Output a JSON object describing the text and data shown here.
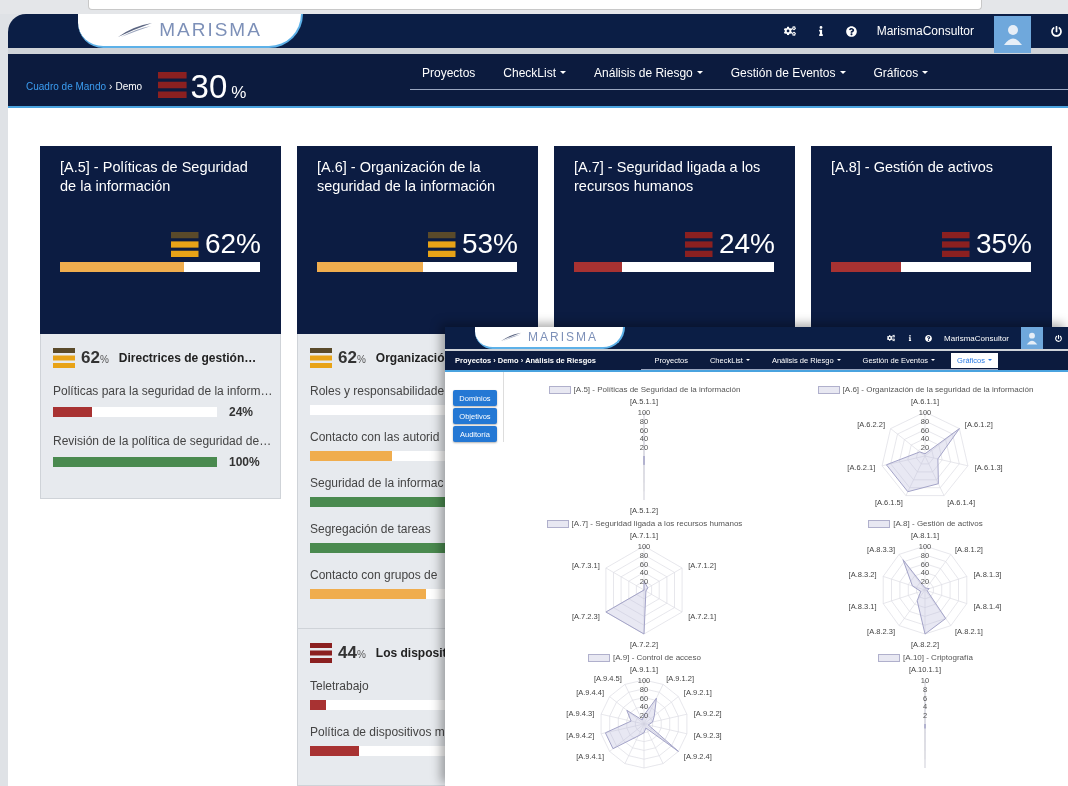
{
  "header": {
    "logo": "MARISMA",
    "user": "MarismaConsultor"
  },
  "subheader": {
    "breadcrumb": [
      {
        "label": "Cuadro de Mando",
        "link": true
      },
      {
        "label": "Demo",
        "link": false
      }
    ],
    "separator": "›",
    "total": {
      "value": "30",
      "unit": "%"
    },
    "nav": [
      {
        "label": "Proyectos",
        "dropdown": false
      },
      {
        "label": "CheckList",
        "dropdown": true
      },
      {
        "label": "Análisis de Riesgo",
        "dropdown": true
      },
      {
        "label": "Gestión de Eventos",
        "dropdown": true
      },
      {
        "label": "Gráficos",
        "dropdown": true
      }
    ]
  },
  "cards": [
    {
      "title": "[A.5] - Políticas de Seguridad de la información",
      "value": "62%",
      "level": 0.62
    },
    {
      "title": "[A.6] - Organización de la seguridad de la información",
      "value": "53%",
      "level": 0.53
    },
    {
      "title": "[A.7] - Seguridad ligada a los recursos humanos",
      "value": "24%",
      "level": 0.24
    },
    {
      "title": "[A.8] - Gestión de activos",
      "value": "35%",
      "level": 0.35
    }
  ],
  "details": [
    {
      "groups": [
        {
          "value": "62",
          "unit": "%",
          "title": "Directrices de gestión…",
          "items": [
            {
              "label": "Políticas para la seguridad de la inform…",
              "level": 0.24,
              "value": "24%"
            },
            {
              "label": "Revisión de la política de seguridad de…",
              "level": 1,
              "value": "100%"
            }
          ]
        }
      ]
    },
    {
      "groups": [
        {
          "value": "62",
          "unit": "%",
          "title": "Organizació",
          "items": [
            {
              "label": "Roles y responsabilidade",
              "level": 0
            },
            {
              "label": "Contacto con las autorid",
              "level": 0.5
            },
            {
              "label": "Seguridad de la informac",
              "level": 1
            },
            {
              "label": "Segregación de tareas",
              "level": 1
            },
            {
              "label": "Contacto con grupos de",
              "level": 0.71
            }
          ]
        },
        {
          "value": "44",
          "unit": "%",
          "title": "Los disposit",
          "items": [
            {
              "label": "Teletrabajo",
              "level": 0.1
            },
            {
              "label": "Política de dispositivos m",
              "level": 0.3
            }
          ]
        }
      ]
    }
  ],
  "overlay": {
    "header": {
      "logo": "MARISMA",
      "user": "MarismaConsultor"
    },
    "breadcrumb": [
      "Proyectos",
      "Demo",
      "Análisis de Riesgos"
    ],
    "separator": "›",
    "nav": [
      {
        "label": "Proyectos",
        "dropdown": false,
        "selected": false
      },
      {
        "label": "CheckList",
        "dropdown": true,
        "selected": false
      },
      {
        "label": "Análisis de Riesgo",
        "dropdown": true,
        "selected": false
      },
      {
        "label": "Gestión de Eventos",
        "dropdown": true,
        "selected": false
      },
      {
        "label": "Gráficos",
        "dropdown": true,
        "selected": true
      }
    ],
    "side_buttons": [
      "Dominios",
      "Objetivos",
      "Auditoría"
    ],
    "charts": [
      {
        "title": "[A.5] - Políticas de Seguridad de la información",
        "ticks": [
          "100",
          "80",
          "60",
          "40",
          "20"
        ],
        "axes": [
          "[A.5.1.1]",
          "[A.5.1.2]"
        ]
      },
      {
        "title": "[A.6] - Organización de la seguridad de la información",
        "ticks": [
          "100",
          "80",
          "60",
          "40",
          "20"
        ],
        "axes": [
          "[A.6.1.1]",
          "[A.6.2.2]",
          "[A.6.1.2]",
          "[A.6.2.1]",
          "[A.6.1.3]",
          "[A.6.1.5]",
          "[A.6.1.4]"
        ]
      },
      {
        "title": "[A.7] - Seguridad ligada a los recursos humanos",
        "ticks": [
          "100",
          "80",
          "60",
          "40",
          "20"
        ],
        "axes": [
          "[A.7.1.1]",
          "[A.7.3.1]",
          "[A.7.1.2]",
          "[A.7.2.3]",
          "[A.7.2.1]",
          "[A.7.2.2]"
        ]
      },
      {
        "title": "[A.8] - Gestión de activos",
        "ticks": [
          "100",
          "80",
          "60",
          "40",
          "20"
        ],
        "axes": [
          "[A.8.1.1]",
          "[A.8.3.3]",
          "[A.8.1.2]",
          "[A.8.3.2]",
          "[A.8.1.3]",
          "[A.8.3.1]",
          "[A.8.1.4]",
          "[A.8.2.3]",
          "[A.8.2.1]",
          "[A.8.2.2]"
        ]
      },
      {
        "title": "[A.9] - Control de acceso",
        "ticks": [
          "100",
          "80",
          "60",
          "40",
          "20"
        ],
        "axes": [
          "[A.9.1.1]",
          "[A.9.4.5]",
          "[A.9.1.2]",
          "[A.9.4.4]",
          "[A.9.2.1]",
          "[A.9.4.3]",
          "[A.9.2.2]",
          "[A.9.4.2]",
          "[A.9.2.3]",
          "[A.9.4.1]",
          "[A.9.2.4]"
        ]
      },
      {
        "title": "[A.10] - Criptografía",
        "ticks": [
          "10",
          "8",
          "6",
          "4",
          "2"
        ],
        "axes": [
          "[A.10.1.1]"
        ]
      }
    ]
  }
}
